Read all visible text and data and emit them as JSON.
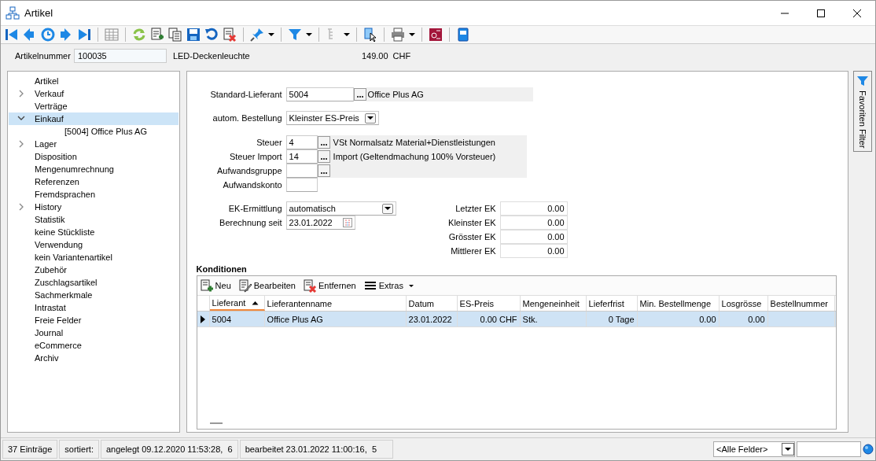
{
  "window": {
    "title": "Artikel"
  },
  "header": {
    "label": "Artikelnummer",
    "value": "100035",
    "description": "LED-Deckenleuchte",
    "price": "149.00",
    "currency": "CHF"
  },
  "nav": [
    {
      "label": "Artikel",
      "has_children": false,
      "expanded": false,
      "selected": false
    },
    {
      "label": "Verkauf",
      "has_children": true,
      "expanded": false,
      "selected": false
    },
    {
      "label": "Verträge",
      "has_children": false,
      "expanded": false,
      "selected": false
    },
    {
      "label": "Einkauf",
      "has_children": true,
      "expanded": true,
      "selected": true,
      "children": [
        {
          "label": "[5004]  Office Plus AG",
          "has_children": false,
          "expanded": false,
          "selected": false
        }
      ]
    },
    {
      "label": "Lager",
      "has_children": true,
      "expanded": false,
      "selected": false
    },
    {
      "label": "Disposition",
      "has_children": false,
      "expanded": false,
      "selected": false
    },
    {
      "label": "Mengenumrechnung",
      "has_children": false,
      "expanded": false,
      "selected": false
    },
    {
      "label": "Referenzen",
      "has_children": false,
      "expanded": false,
      "selected": false
    },
    {
      "label": "Fremdsprachen",
      "has_children": false,
      "expanded": false,
      "selected": false
    },
    {
      "label": "History",
      "has_children": true,
      "expanded": false,
      "selected": false
    },
    {
      "label": "Statistik",
      "has_children": false,
      "expanded": false,
      "selected": false
    },
    {
      "label": "keine Stückliste",
      "has_children": false,
      "expanded": false,
      "selected": false
    },
    {
      "label": "Verwendung",
      "has_children": false,
      "expanded": false,
      "selected": false
    },
    {
      "label": "kein Variantenartikel",
      "has_children": false,
      "expanded": false,
      "selected": false
    },
    {
      "label": "Zubehör",
      "has_children": false,
      "expanded": false,
      "selected": false
    },
    {
      "label": "Zuschlagsartikel",
      "has_children": false,
      "expanded": false,
      "selected": false
    },
    {
      "label": "Sachmerkmale",
      "has_children": false,
      "expanded": false,
      "selected": false
    },
    {
      "label": "Intrastat",
      "has_children": false,
      "expanded": false,
      "selected": false
    },
    {
      "label": "Freie Felder",
      "has_children": false,
      "expanded": false,
      "selected": false
    },
    {
      "label": "Journal",
      "has_children": false,
      "expanded": false,
      "selected": false
    },
    {
      "label": "eCommerce",
      "has_children": false,
      "expanded": false,
      "selected": false
    },
    {
      "label": "Archiv",
      "has_children": false,
      "expanded": false,
      "selected": false
    }
  ],
  "supplier": {
    "label": "Standard-Lieferant",
    "value": "5004",
    "description": "Office Plus AG"
  },
  "auto_order": {
    "label": "autom. Bestellung",
    "value": "Kleinster ES-Preis"
  },
  "accounts": [
    {
      "label": "Steuer",
      "value": "4",
      "lookup": true,
      "description": "VSt Normalsatz Material+Dienstleistungen"
    },
    {
      "label": "Steuer Import",
      "value": "14",
      "lookup": true,
      "description": "Import (Geltendmachung 100% Vorsteuer)"
    },
    {
      "label": "Aufwandsgruppe",
      "lookup": true
    },
    {
      "label": "Aufwandskonto",
      "lookup": false
    }
  ],
  "ek_method": {
    "label": "EK-Ermittlung",
    "value": "automatisch"
  },
  "calc_since": {
    "label": "Berechnung seit",
    "value": "23.01.2022"
  },
  "ek_values": [
    {
      "label": "Letzter EK",
      "value": "0.00"
    },
    {
      "label": "Kleinster EK",
      "value": "0.00"
    },
    {
      "label": "Grösster EK",
      "value": "0.00"
    },
    {
      "label": "Mittlerer EK",
      "value": "0.00"
    }
  ],
  "conditions": {
    "title": "Konditionen",
    "actions": [
      {
        "label": "Neu",
        "kind": "new"
      },
      {
        "label": "Bearbeiten",
        "kind": "edit"
      },
      {
        "label": "Entfernen",
        "kind": "delete"
      },
      {
        "label": "Extras",
        "kind": "menu"
      }
    ],
    "columns": [
      {
        "label": "Lieferant",
        "sorted": true
      },
      {
        "label": "Lieferantenname",
        "sorted": false
      },
      {
        "label": "Datum",
        "sorted": false
      },
      {
        "label": "ES-Preis",
        "sorted": false
      },
      {
        "label": "Mengeneinheit",
        "sorted": false
      },
      {
        "label": "Lieferfrist",
        "sorted": false
      },
      {
        "label": "Min. Bestellmenge",
        "sorted": false
      },
      {
        "label": "Losgrösse",
        "sorted": false
      },
      {
        "label": "Bestellnummer",
        "sorted": false
      }
    ],
    "rows": [
      {
        "selected": true,
        "cells": [
          "5004",
          "Office Plus AG",
          "23.01.2022",
          "0.00 CHF",
          "Stk.",
          "0 Tage",
          "0.00",
          "0.00",
          ""
        ]
      }
    ]
  },
  "side_tab": {
    "label": "Favoriten Filter"
  },
  "status_bar": {
    "sections": [
      "37 Einträge",
      "sortiert:",
      "angelegt 09.12.2020 11:53:28,  6",
      "bearbeitet 23.01.2022 11:00:16,  5"
    ],
    "filter": "<Alle Felder>"
  }
}
